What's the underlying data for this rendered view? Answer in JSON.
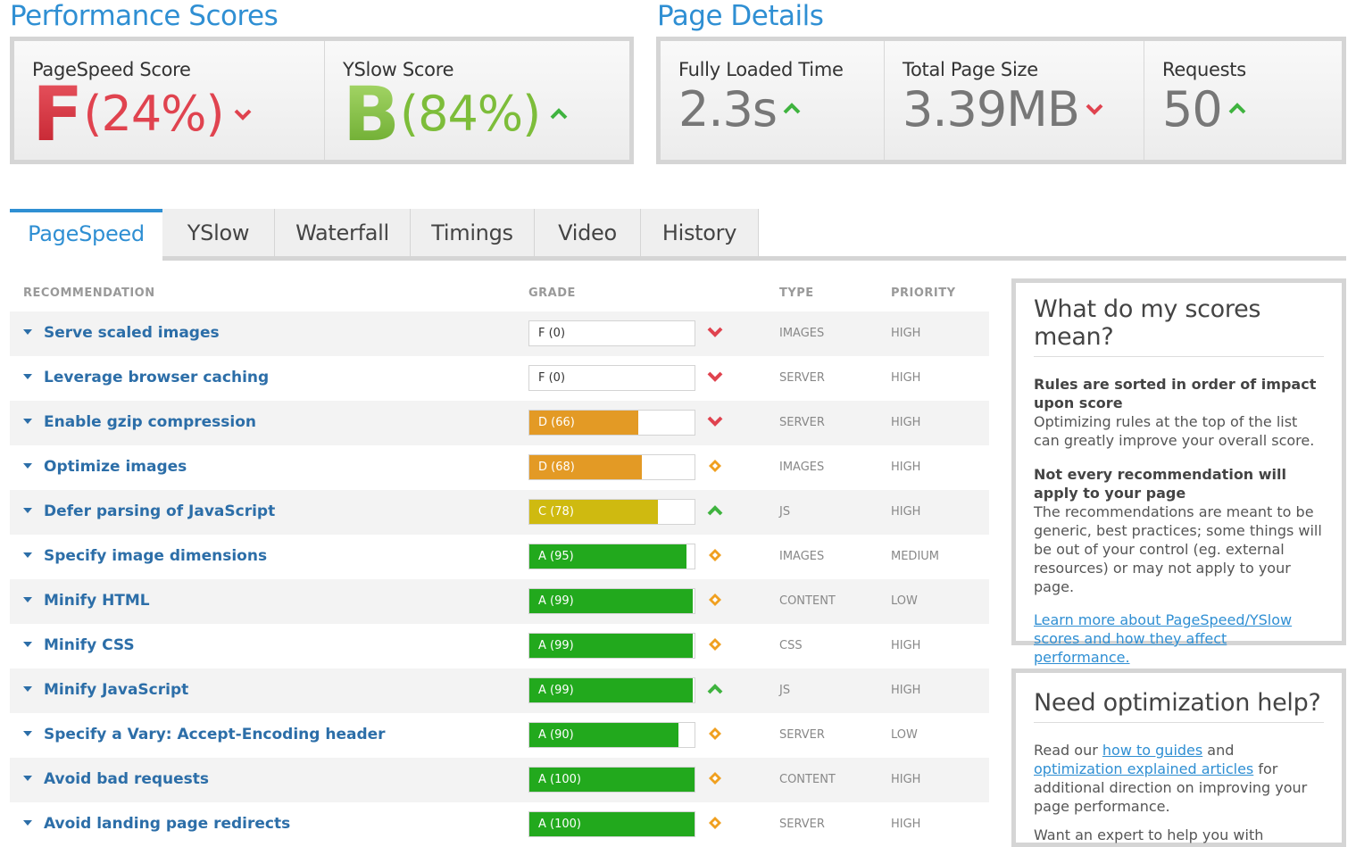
{
  "performance": {
    "title": "Performance Scores",
    "pagespeed_label": "PageSpeed Score",
    "pagespeed_grade": "F",
    "pagespeed_pct": "(24%)",
    "yslow_label": "YSlow Score",
    "yslow_grade": "B",
    "yslow_pct": "(84%)"
  },
  "details": {
    "title": "Page Details",
    "load_label": "Fully Loaded Time",
    "load_value": "2.3s",
    "size_label": "Total Page Size",
    "size_value": "3.39MB",
    "req_label": "Requests",
    "req_value": "50"
  },
  "tabs": [
    "PageSpeed",
    "YSlow",
    "Waterfall",
    "Timings",
    "Video",
    "History"
  ],
  "table": {
    "headers": [
      "RECOMMENDATION",
      "GRADE",
      "TYPE",
      "PRIORITY"
    ],
    "rows": [
      {
        "name": "Serve scaled images",
        "grade": "F (0)",
        "score": 0,
        "color": "#ffffff",
        "trend": "down",
        "type": "IMAGES",
        "priority": "HIGH"
      },
      {
        "name": "Leverage browser caching",
        "grade": "F (0)",
        "score": 0,
        "color": "#ffffff",
        "trend": "down",
        "type": "SERVER",
        "priority": "HIGH"
      },
      {
        "name": "Enable gzip compression",
        "grade": "D (66)",
        "score": 66,
        "color": "#e39a25",
        "trend": "down",
        "type": "SERVER",
        "priority": "HIGH"
      },
      {
        "name": "Optimize images",
        "grade": "D (68)",
        "score": 68,
        "color": "#e39a25",
        "trend": "same",
        "type": "IMAGES",
        "priority": "HIGH"
      },
      {
        "name": "Defer parsing of JavaScript",
        "grade": "C (78)",
        "score": 78,
        "color": "#cfba10",
        "trend": "up",
        "type": "JS",
        "priority": "HIGH"
      },
      {
        "name": "Specify image dimensions",
        "grade": "A (95)",
        "score": 95,
        "color": "#22a91d",
        "trend": "same",
        "type": "IMAGES",
        "priority": "MEDIUM"
      },
      {
        "name": "Minify HTML",
        "grade": "A (99)",
        "score": 99,
        "color": "#22a91d",
        "trend": "same",
        "type": "CONTENT",
        "priority": "LOW"
      },
      {
        "name": "Minify CSS",
        "grade": "A (99)",
        "score": 99,
        "color": "#22a91d",
        "trend": "same",
        "type": "CSS",
        "priority": "HIGH"
      },
      {
        "name": "Minify JavaScript",
        "grade": "A (99)",
        "score": 99,
        "color": "#22a91d",
        "trend": "up",
        "type": "JS",
        "priority": "HIGH"
      },
      {
        "name": "Specify a Vary: Accept-Encoding header",
        "grade": "A (90)",
        "score": 90,
        "color": "#22a91d",
        "trend": "same",
        "type": "SERVER",
        "priority": "LOW"
      },
      {
        "name": "Avoid bad requests",
        "grade": "A (100)",
        "score": 100,
        "color": "#22a91d",
        "trend": "same",
        "type": "CONTENT",
        "priority": "HIGH"
      },
      {
        "name": "Avoid landing page redirects",
        "grade": "A (100)",
        "score": 100,
        "color": "#22a91d",
        "trend": "same",
        "type": "SERVER",
        "priority": "HIGH"
      }
    ]
  },
  "side1": {
    "title": "What do my scores mean?",
    "h1": "Rules are sorted in order of impact upon score",
    "p1": "Optimizing rules at the top of the list can greatly improve your overall score.",
    "h2": "Not every recommendation will apply to your page",
    "p2": "The recommendations are meant to be generic, best practices; some things will be out of your control (eg. external resources) or may not apply to your page.",
    "link": "Learn more about PageSpeed/YSlow scores and how they affect performance."
  },
  "side2": {
    "title": "Need optimization help?",
    "t1": "Read our ",
    "link1": "how to guides",
    "t2": " and ",
    "link2": "optimization explained articles",
    "t3": " for additional direction on improving your page performance.",
    "t4": "Want an expert to help you with"
  },
  "colors": {
    "accent": "#2f8fd3",
    "link": "#2c6ea8",
    "bad": "#e0434f",
    "good": "#3fb33f",
    "neutral": "#f0a020"
  }
}
